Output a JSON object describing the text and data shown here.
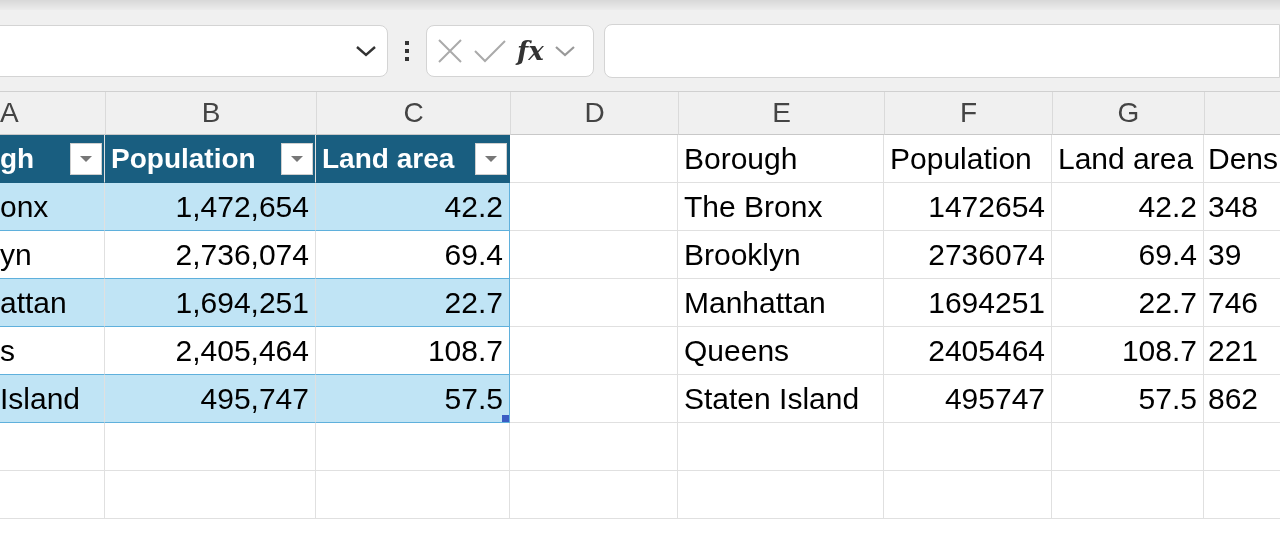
{
  "formula_bar": {
    "function_label": "fx"
  },
  "column_headers": [
    "A",
    "B",
    "C",
    "D",
    "E",
    "F",
    "G"
  ],
  "table": {
    "columns": [
      "gh",
      "Population",
      "Land area"
    ],
    "rows": [
      [
        "onx",
        "1,472,654",
        "42.2"
      ],
      [
        "yn",
        "2,736,074",
        "69.4"
      ],
      [
        "attan",
        "1,694,251",
        "22.7"
      ],
      [
        "s",
        "2,405,464",
        "108.7"
      ],
      [
        "Island",
        "495,747",
        "57.5"
      ]
    ]
  },
  "range": {
    "rows": [
      [
        "Borough",
        "Population",
        "Land area",
        "Dens"
      ],
      [
        "The Bronx",
        "1472654",
        "42.2",
        "348"
      ],
      [
        "Brooklyn",
        "2736074",
        "69.4",
        "39"
      ],
      [
        "Manhattan",
        "1694251",
        "22.7",
        "746"
      ],
      [
        "Queens",
        "2405464",
        "108.7",
        "221"
      ],
      [
        "Staten Island",
        "495747",
        "57.5",
        "862"
      ]
    ]
  }
}
